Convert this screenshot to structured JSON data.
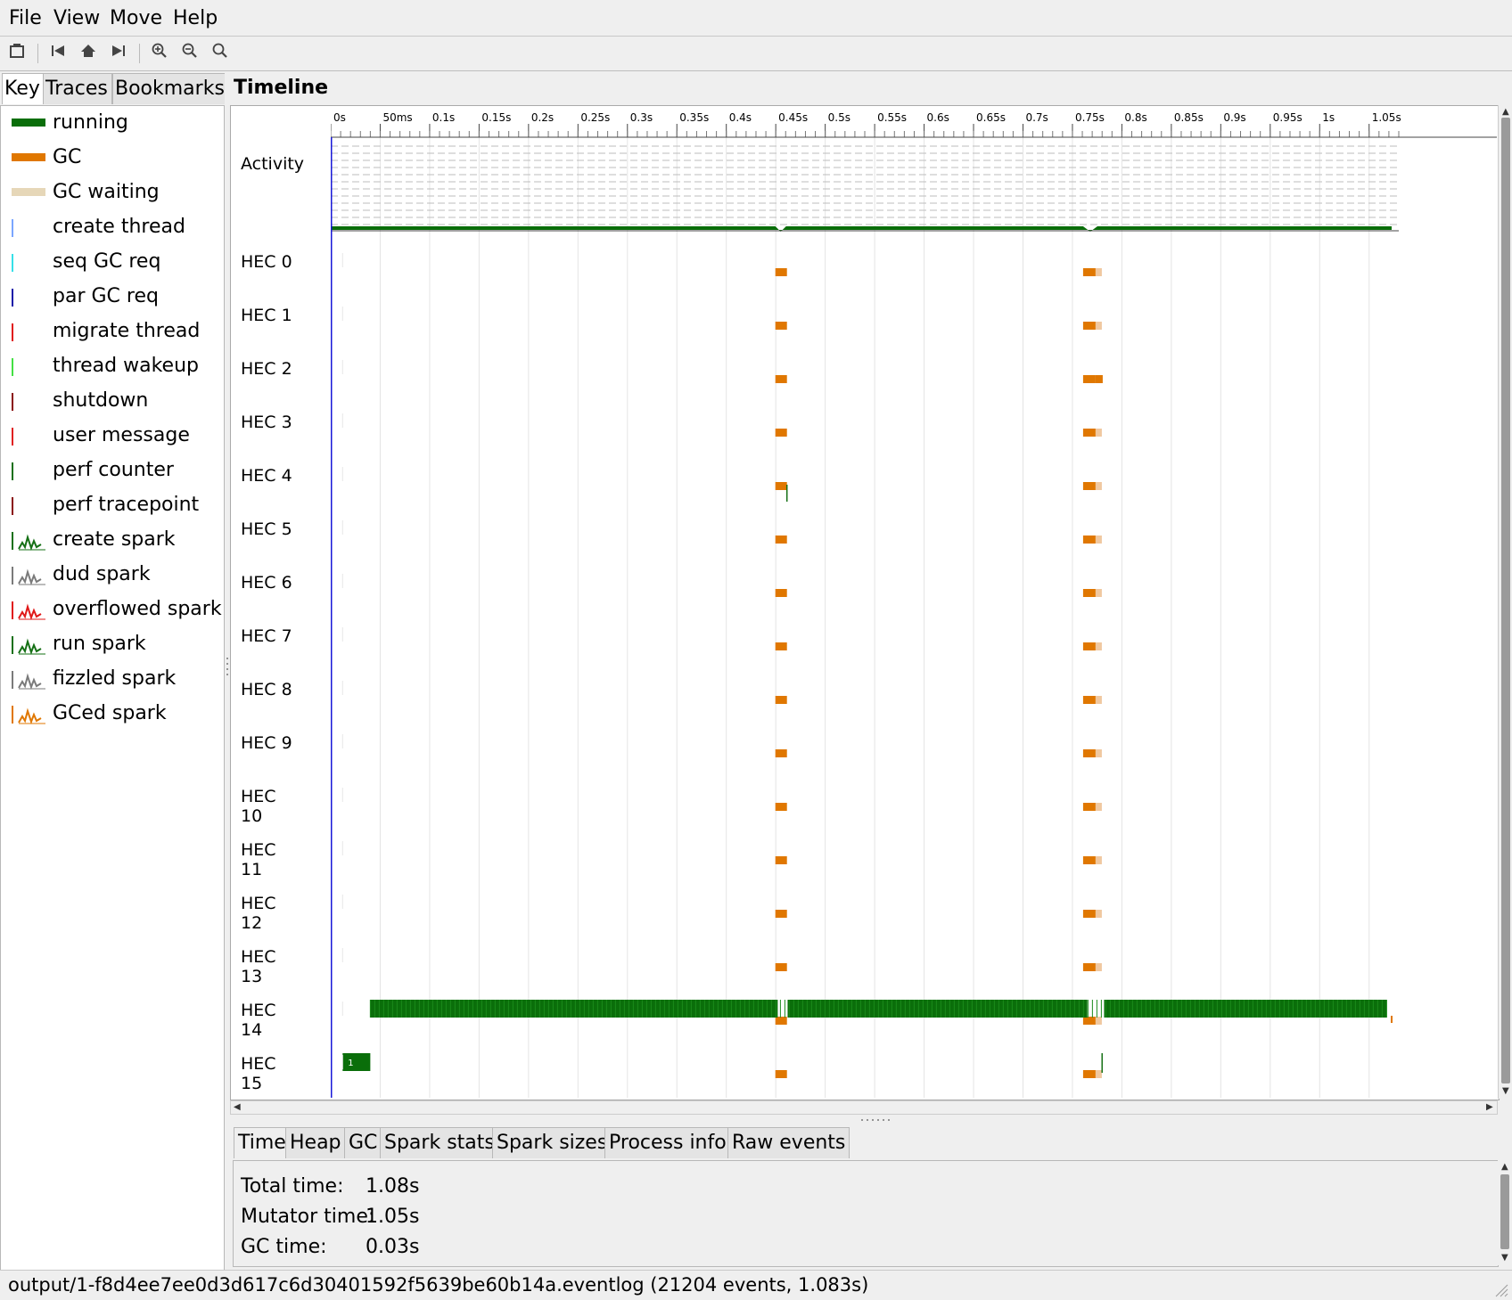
{
  "menu": [
    "File",
    "View",
    "Move",
    "Help"
  ],
  "toolbar_icons": [
    "open-file-icon",
    "jump-start-icon",
    "home-icon",
    "jump-end-icon",
    "zoom-in-icon",
    "zoom-out-icon",
    "zoom-fit-icon"
  ],
  "left_tabs": [
    "Key",
    "Traces",
    "Bookmarks"
  ],
  "key_items": [
    {
      "label": "running",
      "type": "bar",
      "color": "#0a6e0a"
    },
    {
      "label": "GC",
      "type": "bar",
      "color": "#e07700"
    },
    {
      "label": "GC waiting",
      "type": "bar",
      "color": "#e6d7b8"
    },
    {
      "label": "create thread",
      "type": "tick",
      "color": "#7aa6ff"
    },
    {
      "label": "seq GC req",
      "type": "tick",
      "color": "#36e0e8"
    },
    {
      "label": "par GC req",
      "type": "tick",
      "color": "#1818a8"
    },
    {
      "label": "migrate thread",
      "type": "tick",
      "color": "#e01818"
    },
    {
      "label": "thread wakeup",
      "type": "tick",
      "color": "#44e044"
    },
    {
      "label": "shutdown",
      "type": "tick",
      "color": "#8a1010"
    },
    {
      "label": "user message",
      "type": "tick",
      "color": "#e02020"
    },
    {
      "label": "perf counter",
      "type": "tick",
      "color": "#157015"
    },
    {
      "label": "perf tracepoint",
      "type": "tick",
      "color": "#8a1010"
    },
    {
      "label": "create spark",
      "type": "spark",
      "color": "#157015"
    },
    {
      "label": "dud spark",
      "type": "spark",
      "color": "#7a7a7a"
    },
    {
      "label": "overflowed spark",
      "type": "spark",
      "color": "#e01818"
    },
    {
      "label": "run spark",
      "type": "spark",
      "color": "#157015"
    },
    {
      "label": "fizzled spark",
      "type": "spark",
      "color": "#7a7a7a"
    },
    {
      "label": "GCed spark",
      "type": "spark",
      "color": "#e07700"
    }
  ],
  "timeline": {
    "title": "Timeline",
    "activity_label": "Activity",
    "tick_labels": [
      "0s",
      "50ms",
      "0.1s",
      "0.15s",
      "0.2s",
      "0.25s",
      "0.3s",
      "0.35s",
      "0.4s",
      "0.45s",
      "0.5s",
      "0.55s",
      "0.6s",
      "0.65s",
      "0.7s",
      "0.75s",
      "0.8s",
      "0.85s",
      "0.9s",
      "0.95s",
      "1s",
      "1.05s"
    ],
    "hec_labels": [
      "HEC 0",
      "HEC 1",
      "HEC 2",
      "HEC 3",
      "HEC 4",
      "HEC 5",
      "HEC 6",
      "HEC 7",
      "HEC 8",
      "HEC 9",
      "HEC\n10",
      "HEC\n11",
      "HEC\n12",
      "HEC\n13",
      "HEC\n14",
      "HEC\n15"
    ],
    "gc_times": [
      0.455,
      0.768
    ],
    "running_segments_hec14": [
      [
        0.04,
        0.452
      ],
      [
        0.462,
        0.765
      ],
      [
        0.782,
        1.068
      ]
    ],
    "hec15_block_label": "1"
  },
  "bottom_tabs": [
    "Time",
    "Heap",
    "GC",
    "Spark stats",
    "Spark sizes",
    "Process info",
    "Raw events"
  ],
  "stats": [
    {
      "label": "Total time:",
      "value": "1.08s"
    },
    {
      "label": "Mutator time:",
      "value": "1.05s"
    },
    {
      "label": "GC time:",
      "value": "0.03s"
    }
  ],
  "status": "output/1-f8d4ee7ee0d3d617c6d30401592f5639be60b14a.eventlog (21204 events, 1.083s)"
}
